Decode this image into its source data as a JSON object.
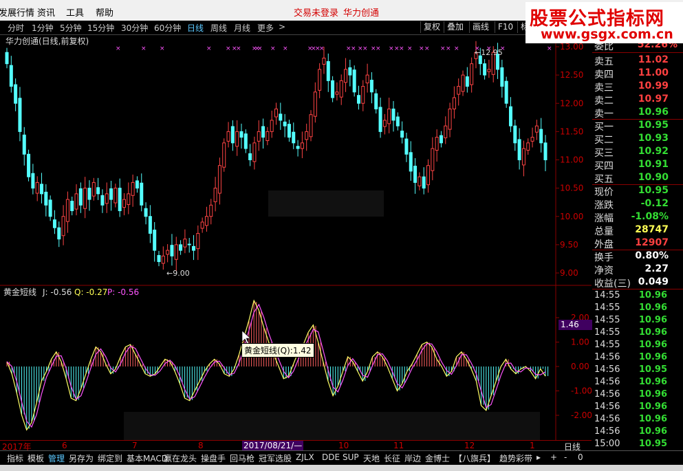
{
  "menubar": {
    "items": [
      "发展行情",
      "资讯",
      "工具",
      "帮助"
    ],
    "login": "交易未登录",
    "stock": "华力创通"
  },
  "logo": {
    "line1": "股票公式指标网",
    "line2": "www.gsgx.com.cn"
  },
  "periods": [
    "分时",
    "1分钟",
    "5分钟",
    "15分钟",
    "30分钟",
    "60分钟",
    "日线",
    "周线",
    "月线",
    "更多",
    ">"
  ],
  "active_period": "日线",
  "toolbar": [
    "复权",
    "叠加",
    "画线",
    "F10",
    "标"
  ],
  "main_chart": {
    "title": "华力创通(日线,前复权)",
    "y_ticks": [
      "13.00",
      "12.50",
      "12.00",
      "11.50",
      "11.00",
      "10.50",
      "10.00",
      "9.50",
      "9.00"
    ],
    "high_label": "12.95",
    "low_label": "9.00"
  },
  "indicator": {
    "name": "黄金短线",
    "j_label": "J: -0.56",
    "q_label": "Q: -0.27",
    "p_label": "P: -0.56",
    "y_ticks": [
      "2.00",
      "1.00",
      "0.00",
      "-1.00",
      "-2.00"
    ],
    "current_value": "1.46",
    "tooltip": "黄金短线(Q):1.42"
  },
  "xaxis": {
    "labels": [
      "2017年",
      "6",
      "7",
      "8",
      "2017/08/21/—",
      "10",
      "11",
      "12",
      "1"
    ],
    "period": "日线"
  },
  "quote": {
    "wb_label": "委比",
    "wb_value": "52.26%",
    "sells": [
      {
        "label": "卖五",
        "price": "11.02",
        "vol": ""
      },
      {
        "label": "卖四",
        "price": "11.00",
        "vol": ""
      },
      {
        "label": "卖三",
        "price": "10.99",
        "vol": ""
      },
      {
        "label": "卖二",
        "price": "10.97",
        "vol": ""
      },
      {
        "label": "卖一",
        "price": "10.96",
        "vol": ""
      }
    ],
    "buys": [
      {
        "label": "买一",
        "price": "10.95",
        "vol": ""
      },
      {
        "label": "买二",
        "price": "10.93",
        "vol": ""
      },
      {
        "label": "买三",
        "price": "10.92",
        "vol": ""
      },
      {
        "label": "买四",
        "price": "10.91",
        "vol": ""
      },
      {
        "label": "买五",
        "price": "10.90",
        "vol": ""
      }
    ],
    "stats": [
      {
        "label": "现价",
        "value": "10.95"
      },
      {
        "label": "涨跌",
        "value": "-0.12"
      },
      {
        "label": "涨幅",
        "value": "-1.08%"
      },
      {
        "label": "总量",
        "value": "28747"
      },
      {
        "label": "外盘",
        "value": "12907"
      }
    ],
    "stats2": [
      {
        "label": "换手",
        "value": "0.80%"
      },
      {
        "label": "净资",
        "value": "2.27"
      },
      {
        "label": "收益(三)",
        "value": "0.049"
      }
    ],
    "ticks": [
      {
        "time": "14:55",
        "price": "10.96"
      },
      {
        "time": "14:55",
        "price": "10.96"
      },
      {
        "time": "14:55",
        "price": "10.96"
      },
      {
        "time": "14:55",
        "price": "10.96"
      },
      {
        "time": "14:55",
        "price": "10.96"
      },
      {
        "time": "14:56",
        "price": "10.96"
      },
      {
        "time": "14:56",
        "price": "10.95"
      },
      {
        "time": "14:56",
        "price": "10.96"
      },
      {
        "time": "14:56",
        "price": "10.96"
      },
      {
        "time": "14:56",
        "price": "10.96"
      },
      {
        "time": "14:56",
        "price": "10.96"
      },
      {
        "time": "14:56",
        "price": "10.96"
      },
      {
        "time": "15:00",
        "price": "10.95"
      }
    ]
  },
  "bottom_tabs": [
    "指标",
    "模板",
    "管理",
    "另存为",
    "绑定到",
    "基本MACD",
    "赢在龙头",
    "操盘手",
    "回马枪",
    "冠军选股",
    "ZJLX",
    "DDE",
    "SUP",
    "天地",
    "长征",
    "岸边",
    "金博士",
    "【八旗兵】",
    "趋势彩带",
    "▸",
    "+",
    "-",
    "0"
  ],
  "active_bottom_tab": "管理"
}
